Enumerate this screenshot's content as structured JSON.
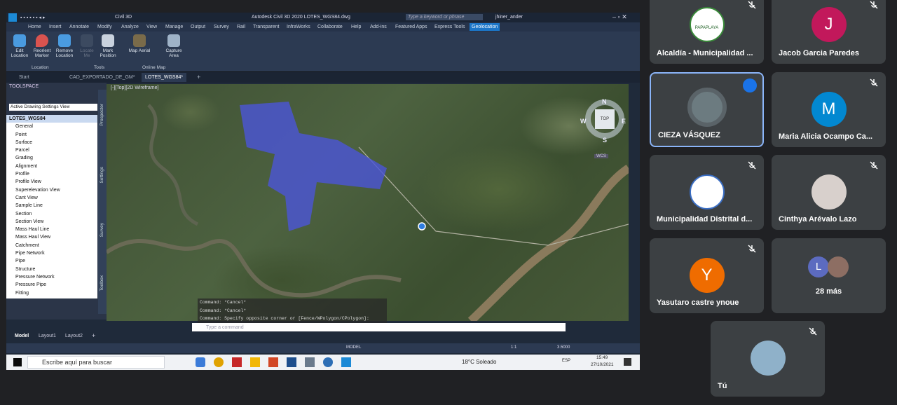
{
  "window": {
    "app": "Civil 3D",
    "title": "Autodesk Civil 3D 2020    LOTES_WGS84.dwg",
    "search_placeholder": "Type a keyword or phrase",
    "user": "jhiner_ander"
  },
  "menu": [
    "Home",
    "Insert",
    "Annotate",
    "Modify",
    "Analyze",
    "View",
    "Manage",
    "Output",
    "Survey",
    "Rail",
    "Transparent",
    "InfraWorks",
    "Collaborate",
    "Help",
    "Add-ins",
    "Featured Apps",
    "Express Tools",
    "Geolocation"
  ],
  "ribbon": {
    "buttons": [
      "Edit Location",
      "Reorient Marker",
      "Remove Location",
      "Locate Me",
      "Mark Position",
      "Map Aerial",
      "Capture Area"
    ],
    "groups": [
      "Location",
      "Tools",
      "Online Map"
    ]
  },
  "doc_tabs": [
    "Start",
    "CAD_EXPORTADO_DE_GM*",
    "LOTES_WGS84*"
  ],
  "toolspace": {
    "title": "TOOLSPACE",
    "view": "Active Drawing Settings View",
    "root": "LOTES_WGS84",
    "items": [
      "General",
      "Point",
      "Surface",
      "Parcel",
      "Grading",
      "Alignment",
      "Profile",
      "Profile View",
      "Superelevation View",
      "Cant View",
      "Sample Line",
      "Section",
      "Section View",
      "Mass Haul Line",
      "Mass Haul View",
      "Catchment",
      "Pipe Network",
      "Pipe",
      "Structure",
      "Pressure Network",
      "Pressure Pipe",
      "Fitting"
    ],
    "side_tabs": [
      "Prospector",
      "Settings",
      "Survey",
      "Toolbox"
    ]
  },
  "viewport": {
    "label": "[-][Top][2D Wireframe]",
    "compass": {
      "n": "N",
      "s": "S",
      "e": "E",
      "w": "W",
      "top": "TOP",
      "wcs": "WCS"
    }
  },
  "commands": [
    "Command: *Cancel*",
    "Command: *Cancel*",
    "Command: Specify opposite corner or [Fence/WPolygon/CPolygon]:"
  ],
  "command_placeholder": "Type a command",
  "layouts": [
    "Model",
    "Layout1",
    "Layout2"
  ],
  "status": {
    "model": "MODEL",
    "scale": "1:1",
    "value": "3.5000"
  },
  "taskbar": {
    "search": "Escribe aquí para buscar",
    "weather": "18°C  Soleado",
    "lang": "ESP",
    "time": "15:49",
    "date": "27/10/2021"
  },
  "participants": [
    {
      "name": "Alcaldía - Municipalidad ...",
      "initial": "",
      "color": "#ffffff"
    },
    {
      "name": "Jacob Garcia Paredes",
      "initial": "J",
      "color": "#c2185b"
    },
    {
      "name": "CIEZA VÁSQUEZ",
      "initial": "",
      "color": "#5f6a72"
    },
    {
      "name": "Maria Alicia Ocampo Ca...",
      "initial": "M",
      "color": "#0288d1"
    },
    {
      "name": "Municipalidad Distrital d...",
      "initial": "",
      "color": "#ffffff"
    },
    {
      "name": "Cinthya Arévalo Lazo",
      "initial": "",
      "color": "#d8d0cc"
    },
    {
      "name": "Yasutaro castre ynoue",
      "initial": "Y",
      "color": "#ef6c00"
    },
    {
      "name": "28 más",
      "initial": "L",
      "color": "#5c6bc0"
    },
    {
      "name": "Tú",
      "initial": "",
      "color": "#8fb1c9"
    }
  ],
  "logo_text": "PAPAPLAYA"
}
